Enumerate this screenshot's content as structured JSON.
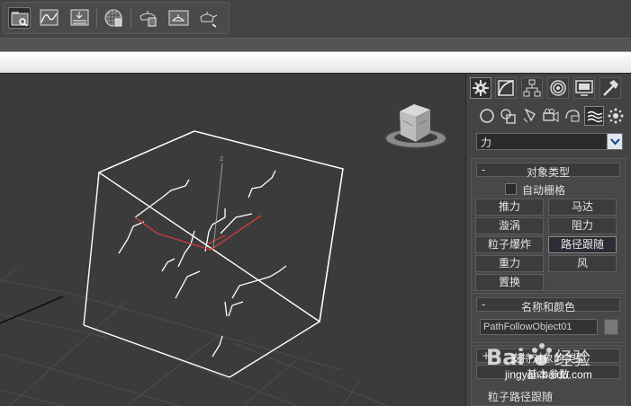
{
  "toolbar": {
    "icons": [
      "scene-explorer-icon",
      "curve-editor-icon",
      "render-setup-icon",
      "material-editor-icon",
      "render-frame-icon",
      "render-production-icon",
      "render-teapot-icon",
      "render-iterative-icon"
    ]
  },
  "viewport": {
    "axis_label": "z"
  },
  "command_panel": {
    "tabs": [
      "create-tab",
      "modify-tab",
      "hierarchy-tab",
      "motion-tab",
      "display-tab",
      "utilities-tab"
    ],
    "subcategories": [
      "geometry",
      "shapes",
      "lights",
      "cameras",
      "helpers",
      "space-warps",
      "systems"
    ],
    "category_dropdown": {
      "value": "力"
    },
    "object_type": {
      "sign": "-",
      "title": "对象类型",
      "autogrid_label": "自动栅格",
      "buttons": [
        {
          "label": "推力",
          "active": false
        },
        {
          "label": "马达",
          "active": false
        },
        {
          "label": "漩涡",
          "active": false
        },
        {
          "label": "阻力",
          "active": false
        },
        {
          "label": "粒子爆炸",
          "active": false
        },
        {
          "label": "路径跟随",
          "active": true
        },
        {
          "label": "重力",
          "active": false
        },
        {
          "label": "风",
          "active": false
        },
        {
          "label": "置换",
          "active": false
        }
      ]
    },
    "name_color": {
      "sign": "-",
      "title": "名称和颜色",
      "object_name": "PathFollowObject01",
      "color": "#777777"
    },
    "supports_types": {
      "sign": "+",
      "title": "支持对象的类型"
    },
    "basic_params": {
      "title": "基本参数"
    },
    "section_label": "粒子路径跟随"
  },
  "watermark": {
    "text": "jingyan.baidu.com"
  }
}
